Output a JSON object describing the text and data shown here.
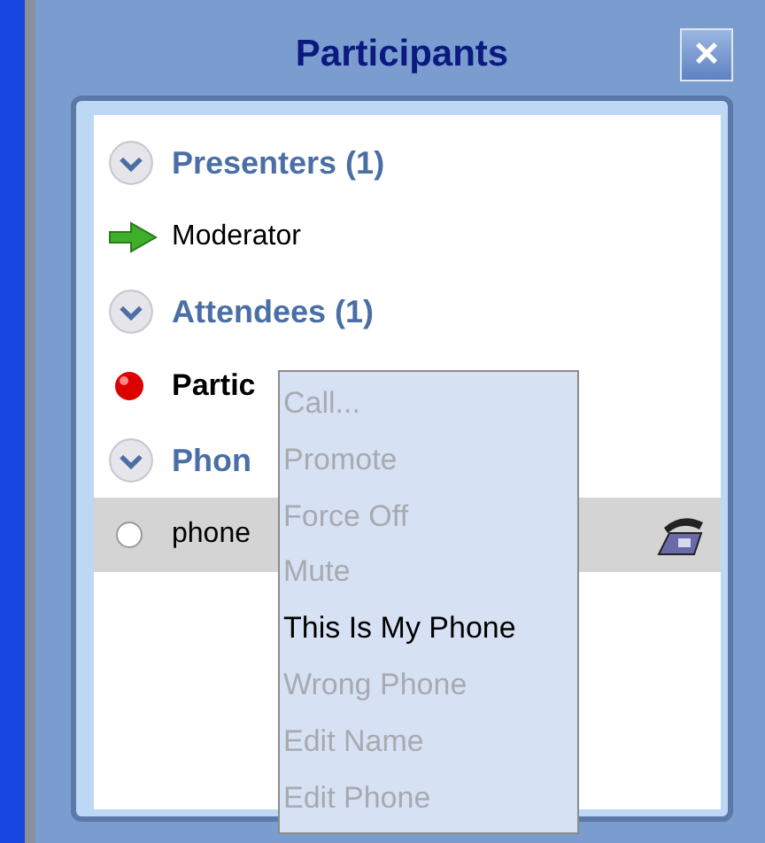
{
  "panel": {
    "title": "Participants",
    "close": "×"
  },
  "groups": [
    {
      "label": "Presenters (1)",
      "expanded": true,
      "members": [
        {
          "name": "Moderator",
          "kind": "presenter",
          "bold": false,
          "selected": false
        }
      ]
    },
    {
      "label": "Attendees (1)",
      "expanded": true,
      "members": [
        {
          "name": "Partic",
          "kind": "attendee",
          "bold": true,
          "selected": false
        }
      ]
    },
    {
      "label": "Phon",
      "expanded": true,
      "members": [
        {
          "name": "phone",
          "kind": "phone",
          "bold": false,
          "selected": true
        }
      ]
    }
  ],
  "context_menu": [
    {
      "label": "Call...",
      "disabled": true
    },
    {
      "label": "Promote",
      "disabled": true
    },
    {
      "label": "Force Off",
      "disabled": true
    },
    {
      "label": "Mute",
      "disabled": true
    },
    {
      "label": "This Is My Phone",
      "disabled": false
    },
    {
      "label": "Wrong Phone",
      "disabled": true
    },
    {
      "label": "Edit Name",
      "disabled": true
    },
    {
      "label": "Edit Phone",
      "disabled": true
    }
  ]
}
